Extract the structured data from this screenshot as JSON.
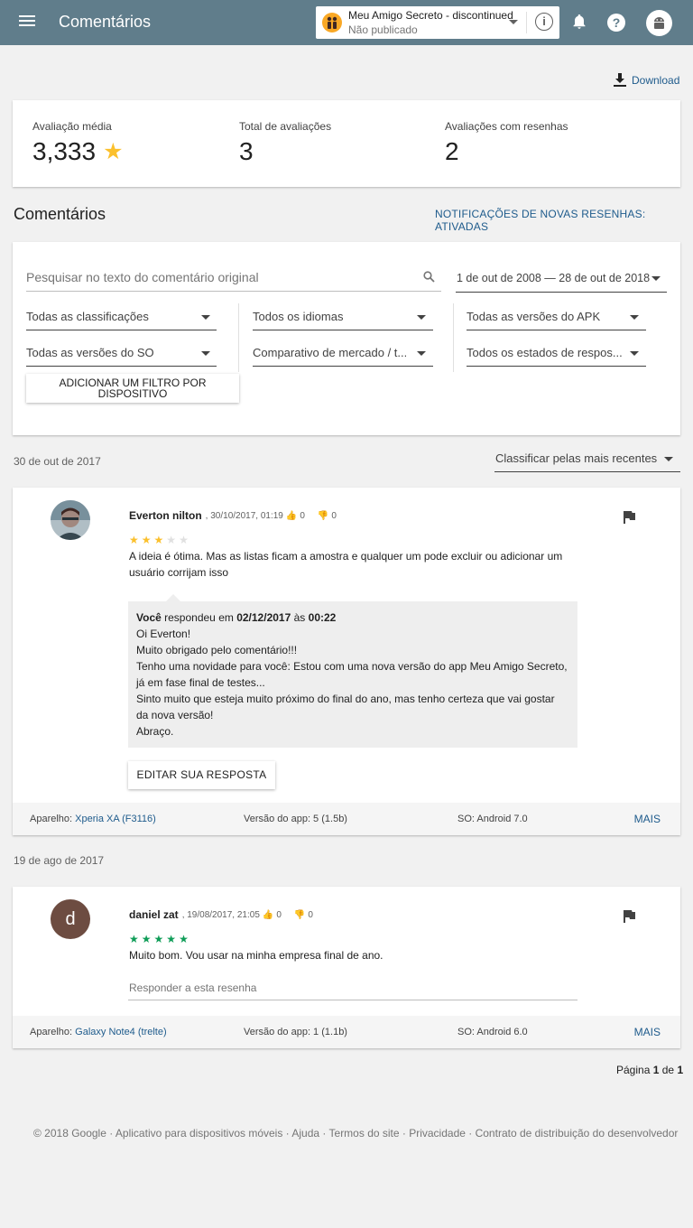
{
  "header": {
    "title": "Comentários",
    "app_name": "Meu Amigo Secreto - discontinued",
    "app_status": "Não publicado",
    "info": "i",
    "help": "?"
  },
  "download": "Download",
  "summary": {
    "avg_label": "Avaliação média",
    "avg_value": "3,333",
    "total_label": "Total de avaliações",
    "total_value": "3",
    "with_reviews_label": "Avaliações com resenhas",
    "with_reviews_value": "2"
  },
  "section": {
    "title": "Comentários",
    "notifications": "NOTIFICAÇÕES DE NOVAS RESENHAS: ATIVADAS"
  },
  "filters": {
    "search_placeholder": "Pesquisar no texto do comentário original",
    "date_range": "1 de out de 2008 — 28 de out de 2018",
    "ratings": "Todas as classificações",
    "languages": "Todos os idiomas",
    "apk_versions": "Todas as versões do APK",
    "os_versions": "Todas as versões do SO",
    "market": "Comparativo de mercado / t...",
    "reply_states": "Todos os estados de respos...",
    "device_filter_button": "ADICIONAR UM FILTRO POR DISPOSITIVO"
  },
  "sort": "Classificar pelas mais recentes",
  "reviews": [
    {
      "date_group": "30 de out de 2017",
      "author": "Everton nilton",
      "meta": ", 30/10/2017, 01:19",
      "likes": "0",
      "dislikes": "0",
      "rating": 3,
      "text": "A ideia é ótima. Mas as listas ficam a amostra e qualquer um pode excluir ou adicionar um usuário corrijam isso",
      "reply": {
        "who": "Você",
        "replied_on": "respondeu em",
        "date": "02/12/2017",
        "at": "às",
        "time": "00:22",
        "lines": [
          "Oi Everton!",
          "Muito obrigado pelo comentário!!!",
          "Tenho uma novidade para você: Estou com uma nova versão do app Meu Amigo Secreto, já em fase final de testes...",
          "Sinto muito que esteja muito próximo do final do ano, mas tenho certeza que vai gostar da nova versão!",
          "Abraço."
        ]
      },
      "edit_button": "EDITAR SUA RESPOSTA",
      "device_label": "Aparelho:",
      "device": "Xperia XA (F3116)",
      "app_version": "Versão do app: 5 (1.5b)",
      "os": "SO: Android 7.0",
      "more": "MAIS"
    },
    {
      "date_group": "19 de ago de 2017",
      "author": "daniel zat",
      "avatar_letter": "d",
      "meta": ", 19/08/2017, 21:05",
      "likes": "0",
      "dislikes": "0",
      "rating": 5,
      "text": "Muito bom. Vou usar na minha empresa final de ano.",
      "reply_placeholder": "Responder a esta resenha",
      "device_label": "Aparelho:",
      "device": "Galaxy Note4 (trelte)",
      "app_version": "Versão do app: 1 (1.1b)",
      "os": "SO: Android 6.0",
      "more": "MAIS"
    }
  ],
  "pagination": {
    "prefix": "Página",
    "current": "1",
    "of": "de",
    "total": "1"
  },
  "footer": {
    "copyright": "© 2018 Google",
    "links": [
      "Aplicativo para dispositivos móveis",
      "Ajuda",
      "Termos do site",
      "Privacidade",
      "Contrato de distribuição do desenvolvedor"
    ]
  },
  "colors": {
    "header": "#607d8b",
    "link": "#1e5b8c",
    "star_yellow": "#fbc02d",
    "star_green": "#0f9d58"
  }
}
